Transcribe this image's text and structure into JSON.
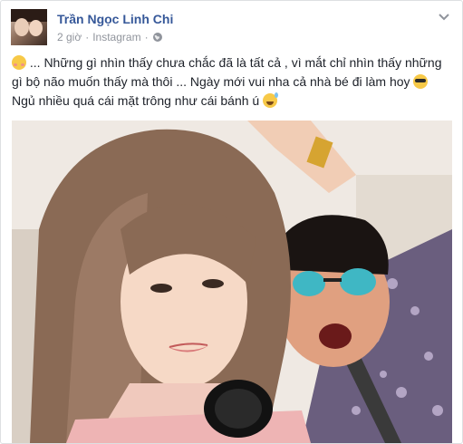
{
  "post": {
    "author_name": "Trần Ngọc Linh Chi",
    "timestamp": "2 giờ",
    "separator": "·",
    "via": "Instagram",
    "separator2": "·",
    "privacy_icon": "globe-icon",
    "menu_icon": "chevron-down-icon",
    "text": {
      "line1_emoji": "blush-smile-emoji",
      "line1": " ... Những gì nhìn thấy chưa chắc đã là tất cả , vì mắt chỉ nhìn thấy những gì bộ não muốn thấy mà thôi ... Ngày mới vui nha cả nhà bé đi làm hoy ",
      "line1_end_emoji": "sunglasses-emoji",
      "line2": "Ngủ nhiều quá cái mặt trông như cái bánh ú ",
      "line2_end_emoji": "grinning-sweat-emoji"
    },
    "photo": {
      "subject": "selfie-photo"
    }
  },
  "colors": {
    "author": "#365899",
    "meta": "#90949c",
    "text": "#1d2129",
    "border": "#dddfe2"
  }
}
